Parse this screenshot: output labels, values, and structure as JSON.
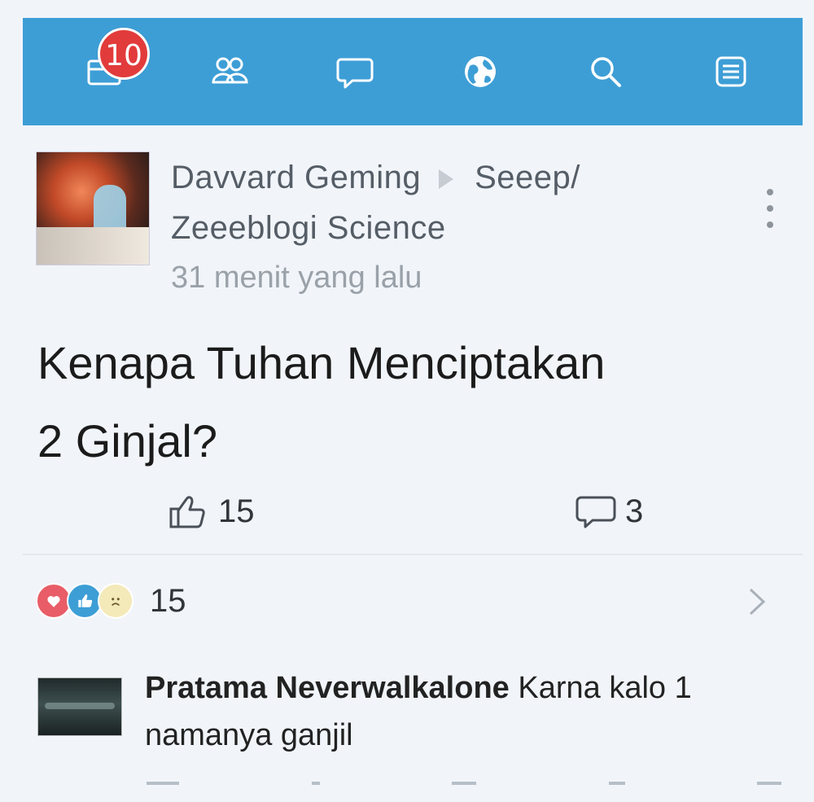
{
  "navbar": {
    "notifications_badge": "10",
    "items": [
      {
        "name": "notifications"
      },
      {
        "name": "friends"
      },
      {
        "name": "messages"
      },
      {
        "name": "globe"
      },
      {
        "name": "search"
      },
      {
        "name": "menu"
      }
    ],
    "color": "#3d9ed6"
  },
  "post": {
    "author": "Davvard Geming",
    "group": "Seeep/",
    "group_line2": "Zeeeblogi Science",
    "time": "31 menit yang lalu",
    "title_line1": "Kenapa Tuhan Menciptakan",
    "title_line2": "2 Ginjal?",
    "likes": "15",
    "comments": "3",
    "reactions_count": "15"
  },
  "comment": {
    "author": "Pratama Neverwalkalone",
    "text_part1": " Karna kalo 1",
    "text_part2": "namanya ganjil"
  }
}
